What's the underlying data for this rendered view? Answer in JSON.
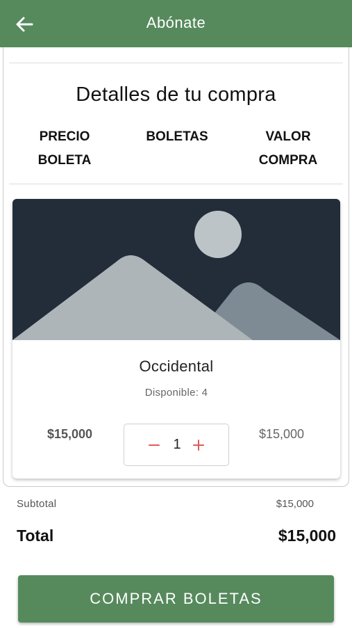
{
  "header": {
    "title": "Abónate",
    "back_icon": "arrow-left-icon",
    "color": "#568a5c"
  },
  "details": {
    "title": "Detalles de tu compra",
    "columns": {
      "price_line1": "PRECIO",
      "price_line2": "BOLETA",
      "tickets": "BOLETAS",
      "value_line1": "VALOR",
      "value_line2": "COMPRA"
    }
  },
  "ticket": {
    "image_icon": "image-placeholder-icon",
    "name": "Occidental",
    "available": "Disponible: 4",
    "price": "$15,000",
    "quantity": "1",
    "decrement_icon": "minus-icon",
    "increment_icon": "plus-icon",
    "value": "$15,000",
    "stepper_color": "#e05a5a"
  },
  "summary": {
    "subtotal_label": "Subtotal",
    "subtotal_value": "$15,000",
    "total_label": "Total",
    "total_value": "$15,000"
  },
  "buy_button": {
    "label": "COMPRAR BOLETAS",
    "color": "#568a5c"
  }
}
